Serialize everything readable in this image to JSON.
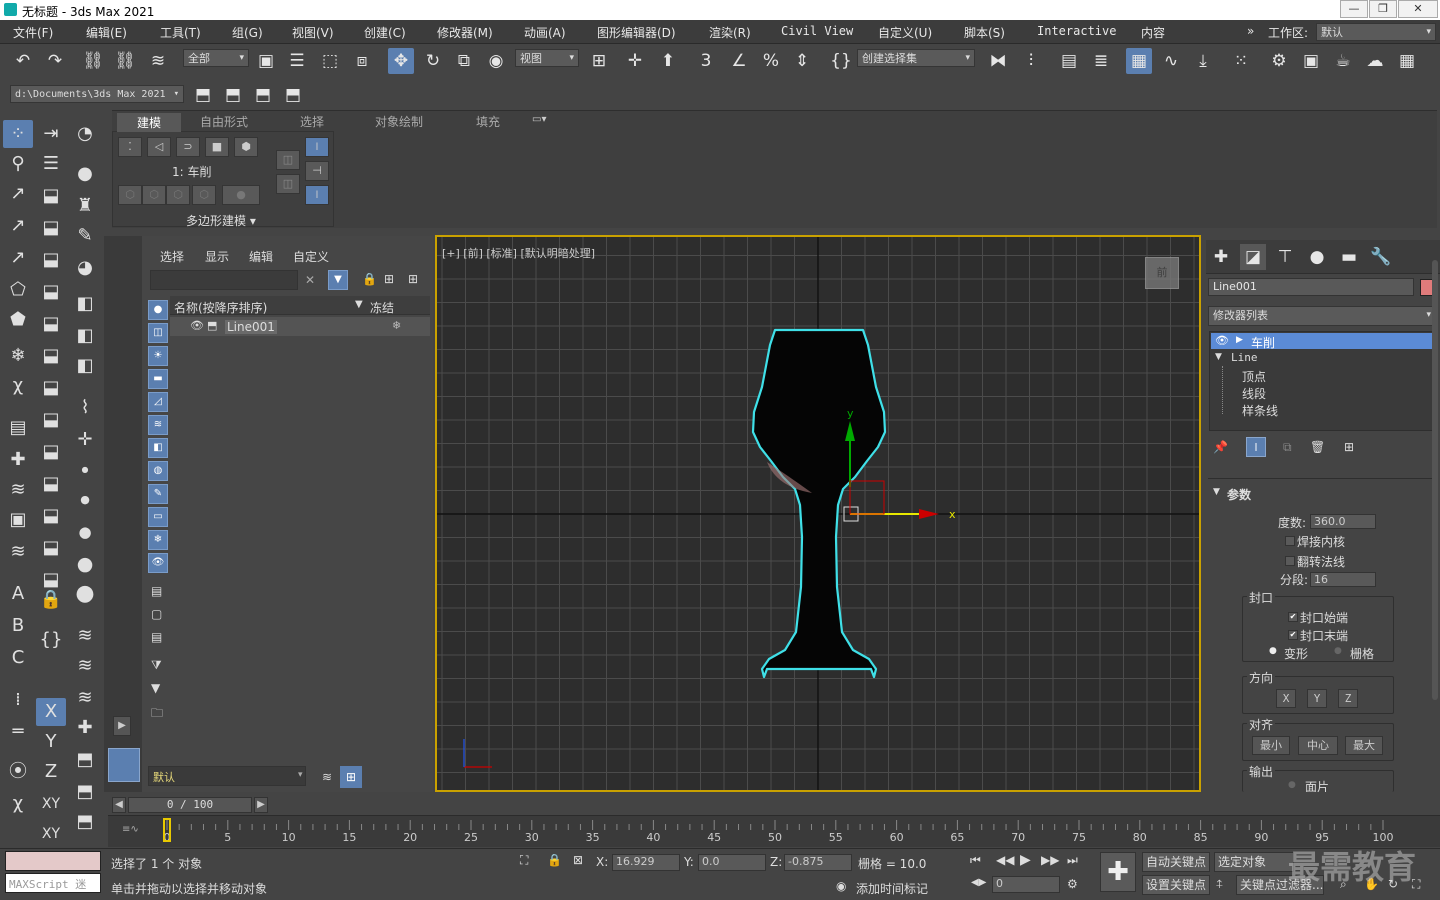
{
  "window": {
    "title": "无标题 - 3ds Max 2021",
    "controls": [
      "—",
      "❐",
      "✕"
    ]
  },
  "menu": [
    "文件(F)",
    "编辑(E)",
    "工具(T)",
    "组(G)",
    "视图(V)",
    "创建(C)",
    "修改器(M)",
    "动画(A)",
    "图形编辑器(D)",
    "渲染(R)",
    "Civil View",
    "自定义(U)",
    "脚本(S)",
    "Interactive",
    "内容"
  ],
  "workspace": {
    "label": "工作区:",
    "value": "默认",
    "chevrons": "»"
  },
  "toolbar": {
    "filter": "全部",
    "ref_coord": "视图",
    "selection_set": "创建选择集",
    "spinner": "3",
    "percent": "%"
  },
  "path": {
    "value": "d:\\Documents\\3ds Max 2021"
  },
  "ribbon": {
    "tabs": [
      "建模",
      "自由形式",
      "选择",
      "对象绘制",
      "填充"
    ],
    "active_tab": "建模",
    "object_label": "1: 车削",
    "poly_label": "多边形建模 ▾"
  },
  "scene_explorer": {
    "tabs": [
      "选择",
      "显示",
      "编辑",
      "自定义"
    ],
    "col_name": "名称(按降序排序)",
    "col_freeze": "冻结",
    "sort_arrow": "▼",
    "object": "Line001",
    "layer": "默认",
    "page": "0 / 100"
  },
  "viewport": {
    "label": "[+] [前] [标准] [默认明暗处理]",
    "axis_y": "y",
    "axis_x": "x",
    "viewcube": "前",
    "border_color": "#c9a100",
    "outline_color": "#3fe0e8"
  },
  "command_panel": {
    "object_name": "Line001",
    "object_color": "#e07b7b",
    "modifier_list": "修改器列表",
    "stack": {
      "active": "车削",
      "base": "Line",
      "subs": [
        "顶点",
        "线段",
        "样条线"
      ]
    },
    "params": {
      "title": "参数",
      "degrees_label": "度数:",
      "degrees": "360.0",
      "weld_core": "焊接内核",
      "flip_normals": "翻转法线",
      "segments_label": "分段:",
      "segments": "16",
      "cap_title": "封口",
      "cap_start": "封口始端",
      "cap_end": "封口末端",
      "morph": "变形",
      "grid": "栅格",
      "direction_title": "方向",
      "dir_x": "X",
      "dir_y": "Y",
      "dir_z": "Z",
      "align_title": "对齐",
      "align_min": "最小",
      "align_center": "中心",
      "align_max": "最大",
      "output_title": "输出",
      "output_patch": "面片"
    }
  },
  "timeline": {
    "ticks": [
      "0",
      "5",
      "10",
      "15",
      "20",
      "25",
      "30",
      "35",
      "40",
      "45",
      "50",
      "55",
      "60",
      "65",
      "70",
      "75",
      "80",
      "85",
      "90",
      "95",
      "100"
    ]
  },
  "status": {
    "maxscript": "MAXScript 迷",
    "line1": "选择了 1 个 对象",
    "line2": "单击并拖动以选择并移动对象",
    "x_label": "X:",
    "x": "16.929",
    "y_label": "Y:",
    "y": "0.0",
    "z_label": "Z:",
    "z": "-0.875",
    "grid": "栅格 = 10.0",
    "add_time_tag": "添加时间标记",
    "frame": "0",
    "auto_key": "自动关键点",
    "selected_object": "选定对象",
    "set_key": "设置关键点",
    "key_filters": "关键点过滤器...",
    "watermark": "最需教育"
  }
}
